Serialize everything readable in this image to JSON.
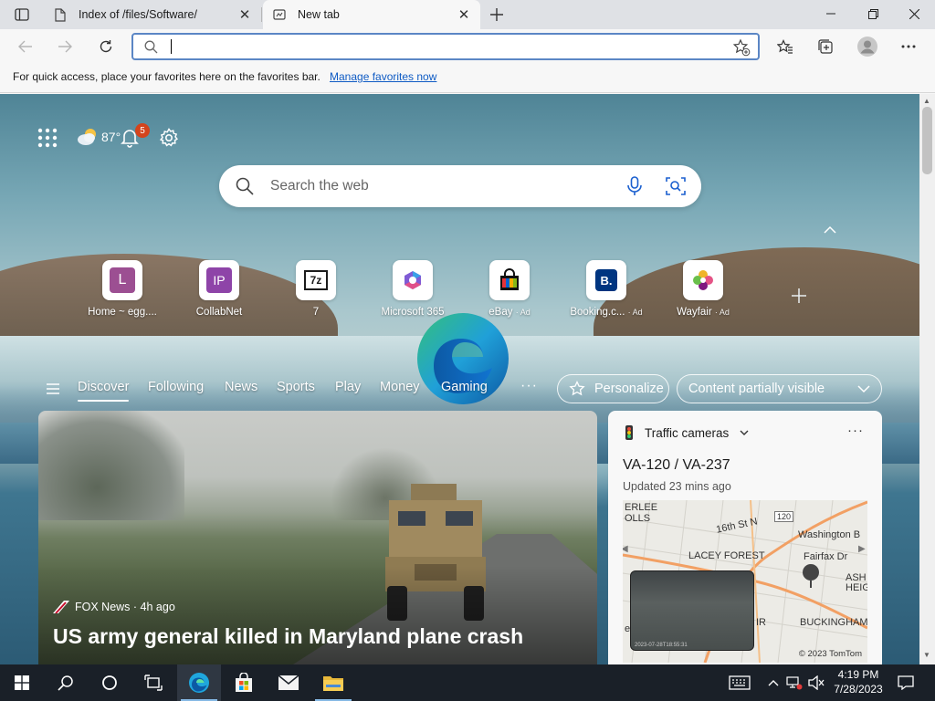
{
  "browser": {
    "tabs": [
      {
        "title": "Index of /files/Software/",
        "active": false
      },
      {
        "title": "New tab",
        "active": true
      }
    ],
    "address": {
      "value": "",
      "placeholder": ""
    },
    "favorites_bar": {
      "message": "For quick access, place your favorites here on the favorites bar.",
      "link": "Manage favorites now"
    }
  },
  "newtab": {
    "weather": {
      "temp": "87°"
    },
    "notifications": {
      "count": "5"
    },
    "search": {
      "placeholder": "Search the web"
    },
    "quick_links": [
      {
        "label": "Home ~ egg....",
        "ad": "",
        "tile_text": "L",
        "tile_color": "#9c4f92"
      },
      {
        "label": "CollabNet",
        "ad": "",
        "tile_text": "IP",
        "tile_color": "#8e44a8"
      },
      {
        "label": "7",
        "ad": "",
        "tile_text": "7z",
        "tile_color": "#1b1b1b"
      },
      {
        "label": "Microsoft 365",
        "ad": "",
        "tile_text": "",
        "tile_color": "#7f5bd5"
      },
      {
        "label": "eBay",
        "ad": "· Ad",
        "tile_text": "",
        "tile_color": "#e53238"
      },
      {
        "label": "Booking.c...",
        "ad": "· Ad",
        "tile_text": "B.",
        "tile_color": "#003580"
      },
      {
        "label": "Wayfair",
        "ad": "· Ad",
        "tile_text": "",
        "tile_color": "#7f187f"
      }
    ],
    "feed_tabs": [
      "Discover",
      "Following",
      "News",
      "Sports",
      "Play",
      "Money",
      "Gaming"
    ],
    "active_feed_tab": "Discover",
    "more": "···",
    "personalize": "Personalize",
    "content_visibility": "Content partially visible",
    "hero": {
      "source": "FOX News",
      "age": "· 4h ago",
      "headline": "US army general killed in Maryland plane crash"
    },
    "traffic": {
      "title": "Traffic cameras",
      "route": "VA-120 / VA-237",
      "updated": "Updated 23 mins ago",
      "map_labels": {
        "l1": "ERLEE",
        "l2": "OLLS",
        "l3": "16th St N",
        "l4": "120",
        "l5": "Washington B",
        "l6": "LACEY FOREST",
        "l7": "Fairfax Dr",
        "l8": "ASH",
        "l9": "HEIG",
        "l10": "BUCKINGHAM",
        "l11": "ev",
        "l12": "IR"
      },
      "copyright": "© 2023 TomTom",
      "cam_timestamp": "2023-07-28T18:55:31"
    }
  },
  "taskbar": {
    "time": "4:19 PM",
    "date": "7/28/2023"
  },
  "colors": {
    "accent": "#0f5bc4",
    "omnibox_border": "#5b86c5",
    "badge": "#d4441c",
    "taskbar": "#1a2028"
  }
}
